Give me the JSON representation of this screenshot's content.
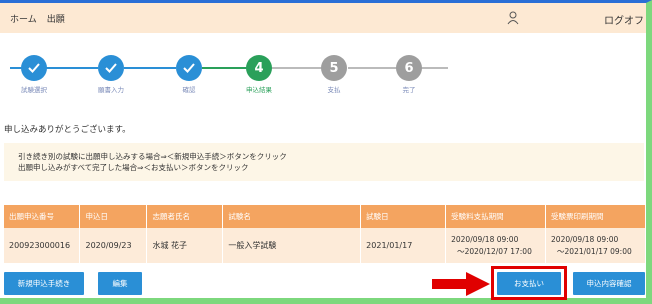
{
  "header": {
    "home": "ホーム",
    "page": "出願",
    "logout": "ログオフ",
    "bg_color": "#fde9d3"
  },
  "steps": [
    {
      "label": "試験選択",
      "state": "done",
      "number": ""
    },
    {
      "label": "願書入力",
      "state": "done",
      "number": ""
    },
    {
      "label": "確認",
      "state": "done",
      "number": ""
    },
    {
      "label": "申込結果",
      "state": "current",
      "number": "4"
    },
    {
      "label": "支払",
      "state": "todo",
      "number": "5"
    },
    {
      "label": "完了",
      "state": "todo",
      "number": "6"
    }
  ],
  "thanks": "申し込みありがとうございます。",
  "info": {
    "line1": "引き続き別の試験に出願申し込みする場合⇒＜新規申込手続＞ボタンをクリック",
    "line2": "出願申し込みがすべて完了した場合⇒＜お支払い＞ボタンをクリック"
  },
  "table": {
    "headers": [
      "出願申込番号",
      "申込日",
      "志願者氏名",
      "試験名",
      "試験日",
      "受験料支払期間",
      "受験票印刷期間"
    ],
    "row": {
      "number": "200923000016",
      "date": "2020/09/23",
      "name": "水城 花子",
      "exam": "一般入学試験",
      "exam_date": "2021/01/17",
      "pay_from": "2020/09/18 09:00",
      "pay_to": "～2020/12/07 17:00",
      "print_from": "2020/09/18 09:00",
      "print_to": "～2021/01/17 09:00"
    }
  },
  "buttons": {
    "new": "新規申込手続き",
    "edit": "編集",
    "pay": "お支払い",
    "confirm": "申込内容確認"
  },
  "colors": {
    "done": "#2a8fd6",
    "current": "#2aa05a",
    "todo": "#9e9e9e",
    "table_header": "#f4a460",
    "highlight": "#e00000"
  }
}
